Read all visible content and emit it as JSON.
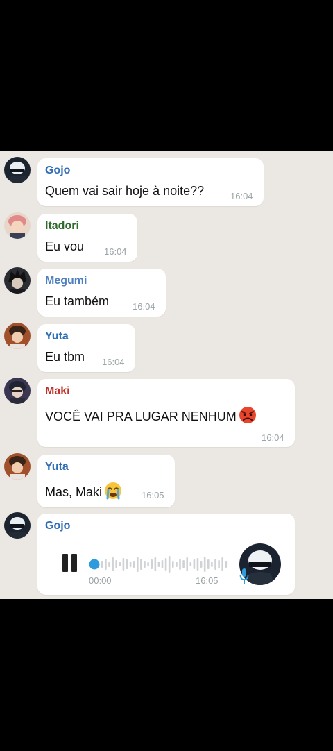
{
  "messages": [
    {
      "sender": "Gojo",
      "text": "Quem vai sair hoje à noite??",
      "time": "16:04",
      "sender_color": "#2f6db5"
    },
    {
      "sender": "Itadori",
      "text": "Eu vou",
      "time": "16:04",
      "sender_color": "#2e6b2a"
    },
    {
      "sender": "Megumi",
      "text": "Eu também",
      "time": "16:04",
      "sender_color": "#4f7fc0"
    },
    {
      "sender": "Yuta",
      "text": "Eu tbm",
      "time": "16:04",
      "sender_color": "#2f6db5"
    },
    {
      "sender": "Maki",
      "text": "VOCÊ VAI PRA LUGAR NENHUM",
      "emoji": "angry-face",
      "time": "16:04",
      "sender_color": "#c0312b"
    },
    {
      "sender": "Yuta",
      "text": "Mas, Maki",
      "emoji": "crying-face",
      "time": "16:05",
      "sender_color": "#2f6db5"
    }
  ],
  "voice_message": {
    "sender": "Gojo",
    "sender_color": "#2f6db5",
    "elapsed": "00:00",
    "time": "16:05",
    "progress": 0,
    "accent": "#2e9bdc"
  },
  "colors": {
    "chat_bg": "#ebe7e2",
    "bubble": "#ffffff",
    "time": "#9aa3a6"
  }
}
